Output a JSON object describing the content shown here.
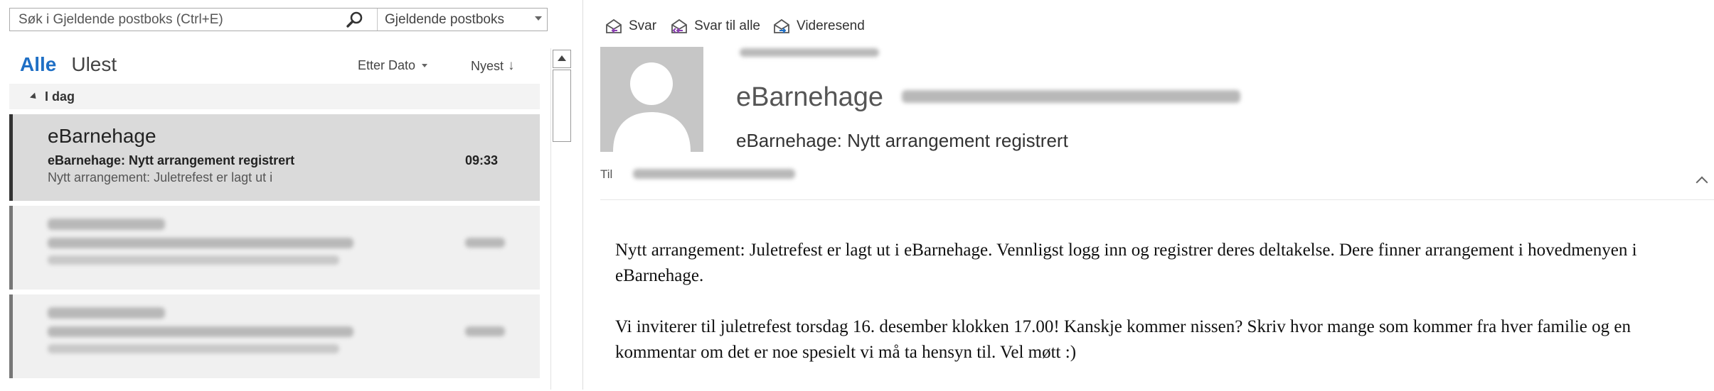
{
  "search": {
    "placeholder": "Søk i Gjeldende postboks (Ctrl+E)",
    "scope": "Gjeldende postboks"
  },
  "filters": {
    "all": "Alle",
    "unread": "Ulest",
    "sort_by": "Etter Dato",
    "order": "Nyest",
    "order_arrow": "↓"
  },
  "list": {
    "group_label": "I dag",
    "selected": {
      "sender": "eBarnehage",
      "subject": "eBarnehage: Nytt arrangement registrert",
      "time": "09:33",
      "preview": "Nytt arrangement: Juletrefest er lagt ut i"
    }
  },
  "toolbar": {
    "reply": "Svar",
    "reply_all": "Svar til alle",
    "forward": "Videresend"
  },
  "message": {
    "from_name": "eBarnehage",
    "subject": "eBarnehage: Nytt arrangement registrert",
    "to_label": "Til",
    "body": [
      "Nytt arrangement: Juletrefest er lagt ut i eBarnehage. Vennligst logg inn og registrer deres deltakelse. Dere finner arrangement i hovedmenyen i eBarnehage.",
      "Vi inviterer til juletrefest torsdag 16. desember klokken 17.00! Kanskje kommer nissen? Skriv hvor mange som kommer fra hver familie og en kommentar om det er noe spesielt vi må ta hensyn til. Vel møtt :)"
    ]
  },
  "colors": {
    "accent": "#1f6fc5",
    "selected_bg": "#dadada",
    "avatar_bg": "#c6c6c6"
  }
}
